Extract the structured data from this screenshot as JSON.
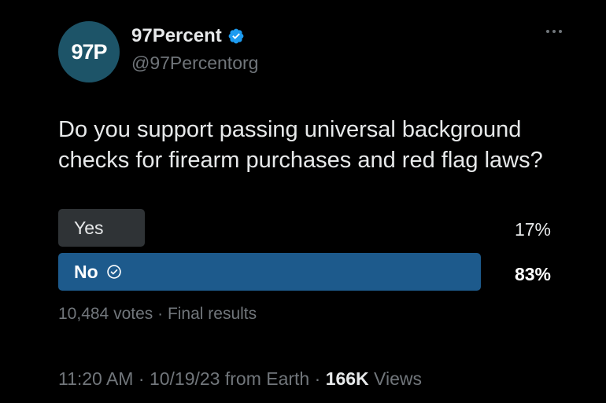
{
  "author": {
    "avatar_text": "97P",
    "display_name": "97Percent",
    "handle": "@97Percentorg",
    "avatar_color": "#1d5468",
    "verified_color": "#1d9bf0"
  },
  "tweet": {
    "text": "Do you support passing universal background checks for firearm purchases and red flag laws?"
  },
  "poll": {
    "options": [
      {
        "label": "Yes",
        "percent": "17%",
        "value": 0.17,
        "selected": false
      },
      {
        "label": "No",
        "percent": "83%",
        "value": 0.83,
        "selected": true
      }
    ],
    "votes": "10,484 votes",
    "separator": " · ",
    "status": "Final results",
    "winner_color": "#1d5a8c",
    "loser_color": "#2f3336"
  },
  "meta": {
    "time": "11:20 AM",
    "sep1": " · ",
    "date": "10/19/23",
    "source": " from Earth",
    "sep2": " · ",
    "views_count": "166K",
    "views_label": " Views"
  },
  "icons": {
    "verified": "verified-badge-icon",
    "check": "check-circle-icon",
    "more": "more-options-icon"
  }
}
